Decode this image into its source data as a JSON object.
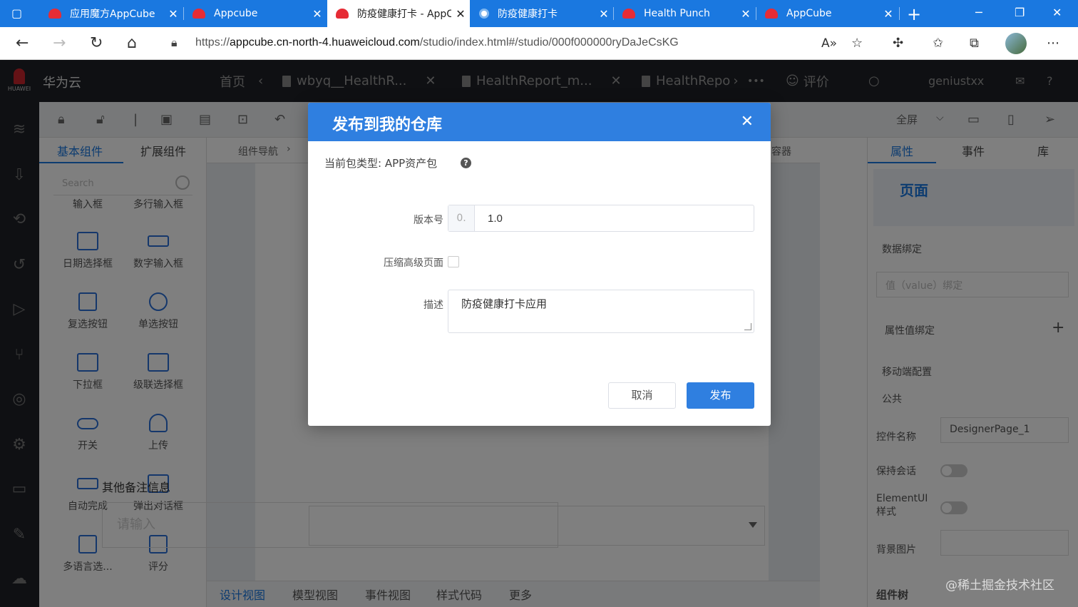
{
  "browser": {
    "tabs": [
      {
        "title": "应用魔方AppCube",
        "icon": "huawei-logo-icon",
        "active": false
      },
      {
        "title": "Appcube",
        "icon": "huawei-logo-icon",
        "active": false
      },
      {
        "title": "防疫健康打卡 - AppCube",
        "icon": "huawei-logo-icon",
        "active": true
      },
      {
        "title": "防疫健康打卡",
        "icon": "globe-icon",
        "active": false
      },
      {
        "title": "Health Punch",
        "icon": "huawei-logo-icon",
        "active": false
      },
      {
        "title": "AppCube",
        "icon": "huawei-logo-icon",
        "active": false
      }
    ],
    "url_prefix": "https://",
    "url_host": "appcube.cn-north-4.huaweicloud.com",
    "url_path": "/studio/index.html#/studio/000f000000ryDaJeCsKG",
    "accent": "#1a78e0"
  },
  "app": {
    "brand_logo_text": "HUAWEI",
    "brand": "华为云",
    "tabs": [
      {
        "label": "首页"
      },
      {
        "label": "wbyq__HealthR..."
      },
      {
        "label": "HealthReport_m..."
      },
      {
        "label": "HealthRepo"
      }
    ],
    "more": "•••",
    "rate": "评价",
    "user": "geniustxx",
    "toolbar": {
      "fullscreen": "全屏"
    },
    "components": {
      "tabs": [
        "基本组件",
        "扩展组件"
      ],
      "search_placeholder": "Search",
      "items": [
        "输入框",
        "多行输入框",
        "日期选择框",
        "数字输入框",
        "复选按钮",
        "单选按钮",
        "下拉框",
        "级联选择框",
        "开关",
        "上传",
        "自动完成",
        "弹出对话框",
        "多语言选...",
        "评分"
      ]
    },
    "breadcrumb": "组件导航",
    "container_label": "容器",
    "canvas": {
      "other_label": "其他备注信息",
      "other_placeholder": "请输入"
    },
    "bottom_tabs": [
      "设计视图",
      "模型视图",
      "事件视图",
      "样式代码",
      "更多"
    ],
    "props": {
      "tabs": [
        "属性",
        "事件",
        "库"
      ],
      "page_title": "页面",
      "data_binding": "数据绑定",
      "value_binding_placeholder": "值（value）绑定",
      "attr_binding": "属性值绑定",
      "mobile_config": "移动端配置",
      "common": "公共",
      "control_name_label": "控件名称",
      "control_name_value": "DesignerPage_1",
      "keep_session": "保持会话",
      "element_ui": "ElementUI样式",
      "bg_image": "背景图片",
      "component_tree": "组件树"
    }
  },
  "watermark": "@稀土掘金技术社区",
  "modal": {
    "title": "发布到我的仓库",
    "package_type": "当前包类型: APP资产包",
    "version_label": "版本号",
    "version_prefix": "0.",
    "version_value": "1.0",
    "compress_label": "压缩高级页面",
    "compress_checked": false,
    "desc_label": "描述",
    "desc_value": "防疫健康打卡应用",
    "cancel": "取消",
    "publish": "发布",
    "header_color": "#2f7fe0"
  }
}
